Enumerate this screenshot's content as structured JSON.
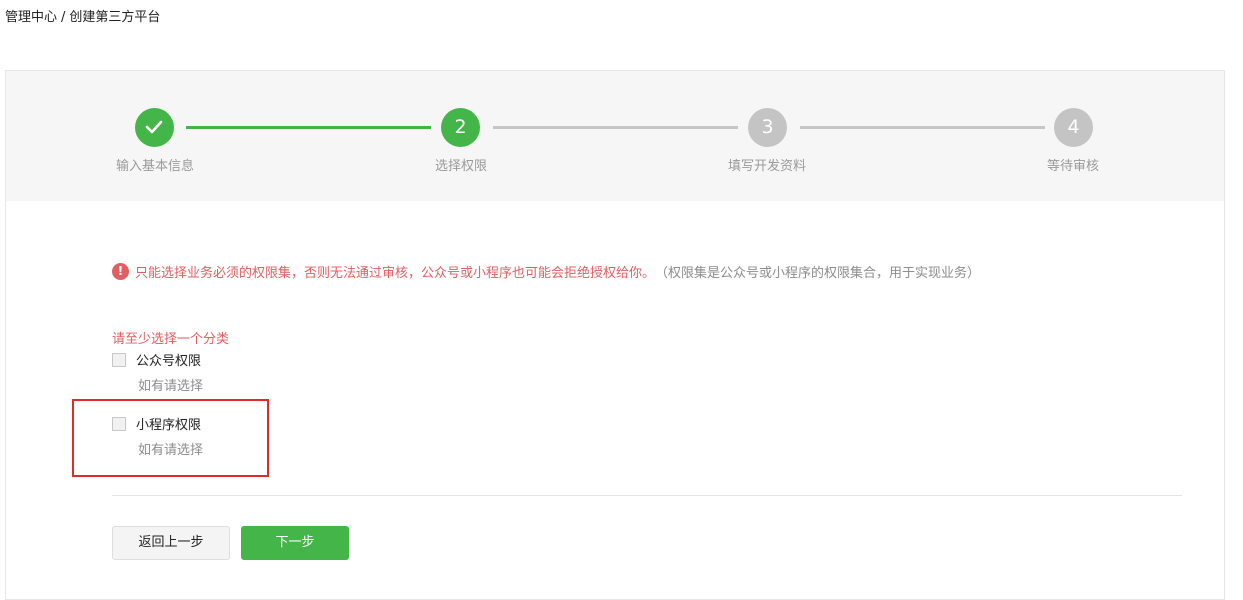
{
  "breadcrumb": {
    "root": "管理中心",
    "separator": "/",
    "current": "创建第三方平台"
  },
  "steps": [
    {
      "number": "1",
      "label": "输入基本信息",
      "status": "done"
    },
    {
      "number": "2",
      "label": "选择权限",
      "status": "active"
    },
    {
      "number": "3",
      "label": "填写开发资料",
      "status": "pending"
    },
    {
      "number": "4",
      "label": "等待审核",
      "status": "pending"
    }
  ],
  "warning": {
    "icon": "!",
    "main": "只能选择业务必须的权限集，否则无法通过审核，公众号或小程序也可能会拒绝授权给你。",
    "sub": "（权限集是公众号或小程序的权限集合，用于实现业务）"
  },
  "required_tip": "请至少选择一个分类",
  "options": [
    {
      "label": "公众号权限",
      "desc": "如有请选择",
      "checked": false
    },
    {
      "label": "小程序权限",
      "desc": "如有请选择",
      "checked": false
    }
  ],
  "buttons": {
    "back": "返回上一步",
    "next": "下一步"
  },
  "colors": {
    "primary": "#44b549",
    "pending": "#c4c4c4",
    "warning": "#e15f63",
    "highlight": "#e02b2b"
  }
}
